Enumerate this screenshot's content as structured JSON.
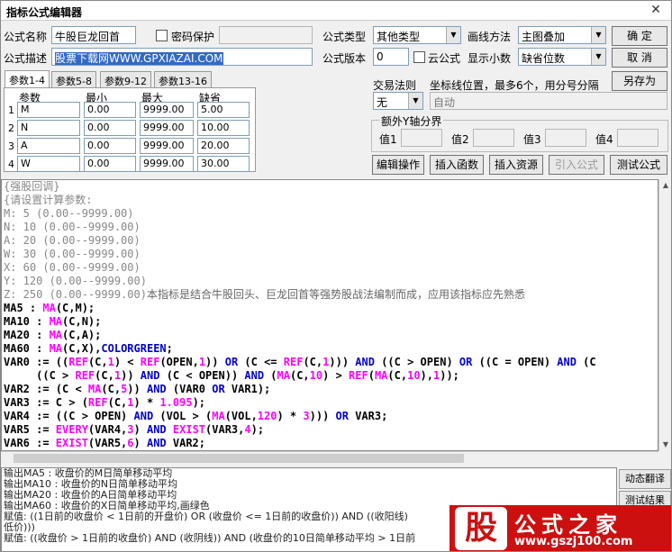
{
  "window": {
    "title": "指标公式编辑器",
    "close": "✕"
  },
  "form": {
    "name_label": "公式名称",
    "name_value": "牛股巨龙回首",
    "password_label": "密码保护",
    "desc_label": "公式描述",
    "desc_value": "股票下载网WWW.GPXIAZAI.COM",
    "type_label": "公式类型",
    "type_value": "其他类型",
    "draw_label": "画线方法",
    "draw_value": "主图叠加",
    "version_label": "公式版本",
    "version_value": "0",
    "cloud_label": "云公式",
    "decimal_label": "显示小数",
    "decimal_value": "缺省位数",
    "trade_label": "交易法则",
    "trade_value": "无",
    "axis_label": "坐标线位置，最多6个，用分号分隔",
    "axis_value": "自动",
    "yaxis_group": "额外Y轴分界",
    "yaxis_labels": [
      "值1",
      "值2",
      "值3",
      "值4"
    ]
  },
  "buttons": {
    "ok": "确  定",
    "cancel": "取  消",
    "saveas": "另存为",
    "edit_op": "编辑操作",
    "insert_fn": "插入函数",
    "insert_res": "插入资源",
    "import": "引入公式",
    "test": "测试公式"
  },
  "tabs": [
    "参数1-4",
    "参数5-8",
    "参数9-12",
    "参数13-16"
  ],
  "param_table": {
    "headers": [
      "参数",
      "最小",
      "最大",
      "缺省"
    ],
    "rows": [
      {
        "idx": "1",
        "name": "M",
        "min": "0.00",
        "max": "9999.00",
        "def": "5.00"
      },
      {
        "idx": "2",
        "name": "N",
        "min": "0.00",
        "max": "9999.00",
        "def": "10.00"
      },
      {
        "idx": "3",
        "name": "A",
        "min": "0.00",
        "max": "9999.00",
        "def": "20.00"
      },
      {
        "idx": "4",
        "name": "W",
        "min": "0.00",
        "max": "9999.00",
        "def": "30.00"
      }
    ]
  },
  "code_lines": [
    [
      {
        "c": "gray",
        "t": "{强股回调}"
      }
    ],
    [
      {
        "c": "gray",
        "t": "{请设置计算参数:"
      }
    ],
    [
      {
        "c": "gray",
        "t": "M: 5 (0.00--9999.00)"
      }
    ],
    [
      {
        "c": "gray",
        "t": "N: 10 (0.00--9999.00)"
      }
    ],
    [
      {
        "c": "gray",
        "t": "A: 20 (0.00--9999.00)"
      }
    ],
    [
      {
        "c": "gray",
        "t": "W: 30 (0.00--9999.00)"
      }
    ],
    [
      {
        "c": "gray",
        "t": "X: 60 (0.00--9999.00)"
      }
    ],
    [
      {
        "c": "gray",
        "t": "Y: 120 (0.00--9999.00)"
      }
    ],
    [
      {
        "c": "gray",
        "t": "Z: 250 (0.00--9999.00)"
      },
      {
        "c": "com",
        "t": "本指标是结合牛股回头、巨龙回首等强势股战法编制而成，应用该指标应先熟悉"
      }
    ],
    [
      {
        "c": "kw",
        "t": "MA5 : "
      },
      {
        "c": "fn",
        "t": "MA"
      },
      {
        "c": "kw",
        "t": "(C,M);"
      }
    ],
    [
      {
        "c": "kw",
        "t": "MA10 : "
      },
      {
        "c": "fn",
        "t": "MA"
      },
      {
        "c": "kw",
        "t": "(C,N);"
      }
    ],
    [
      {
        "c": "kw",
        "t": "MA20 : "
      },
      {
        "c": "fn",
        "t": "MA"
      },
      {
        "c": "kw",
        "t": "(C,A);"
      }
    ],
    [
      {
        "c": "kw",
        "t": "MA60 : "
      },
      {
        "c": "fn",
        "t": "MA"
      },
      {
        "c": "kw",
        "t": "(C,X),"
      },
      {
        "c": "op",
        "t": "COLORGREEN"
      },
      {
        "c": "kw",
        "t": ";"
      }
    ],
    [
      {
        "c": "kw",
        "t": "VAR0 := (("
      },
      {
        "c": "fn",
        "t": "REF"
      },
      {
        "c": "kw",
        "t": "(C,"
      },
      {
        "c": "num",
        "t": "1"
      },
      {
        "c": "kw",
        "t": ") < "
      },
      {
        "c": "fn",
        "t": "REF"
      },
      {
        "c": "kw",
        "t": "(OPEN,"
      },
      {
        "c": "num",
        "t": "1"
      },
      {
        "c": "kw",
        "t": ")) "
      },
      {
        "c": "op",
        "t": "OR"
      },
      {
        "c": "kw",
        "t": " (C <= "
      },
      {
        "c": "fn",
        "t": "REF"
      },
      {
        "c": "kw",
        "t": "(C,"
      },
      {
        "c": "num",
        "t": "1"
      },
      {
        "c": "kw",
        "t": "))) "
      },
      {
        "c": "op",
        "t": "AND"
      },
      {
        "c": "kw",
        "t": " ((C > OPEN) "
      },
      {
        "c": "op",
        "t": "OR"
      },
      {
        "c": "kw",
        "t": " ((C = OPEN) "
      },
      {
        "c": "op",
        "t": "AND"
      },
      {
        "c": "kw",
        "t": " (C"
      }
    ],
    [
      {
        "c": "kw",
        "t": "     ((C > "
      },
      {
        "c": "fn",
        "t": "REF"
      },
      {
        "c": "kw",
        "t": "(C,"
      },
      {
        "c": "num",
        "t": "1"
      },
      {
        "c": "kw",
        "t": ")) "
      },
      {
        "c": "op",
        "t": "AND"
      },
      {
        "c": "kw",
        "t": " (C < OPEN)) "
      },
      {
        "c": "op",
        "t": "AND"
      },
      {
        "c": "kw",
        "t": " ("
      },
      {
        "c": "fn",
        "t": "MA"
      },
      {
        "c": "kw",
        "t": "(C,"
      },
      {
        "c": "num",
        "t": "10"
      },
      {
        "c": "kw",
        "t": ") > "
      },
      {
        "c": "fn",
        "t": "REF"
      },
      {
        "c": "kw",
        "t": "("
      },
      {
        "c": "fn",
        "t": "MA"
      },
      {
        "c": "kw",
        "t": "(C,"
      },
      {
        "c": "num",
        "t": "10"
      },
      {
        "c": "kw",
        "t": "),"
      },
      {
        "c": "num",
        "t": "1"
      },
      {
        "c": "kw",
        "t": "));"
      }
    ],
    [
      {
        "c": "kw",
        "t": "VAR2 := (C < "
      },
      {
        "c": "fn",
        "t": "MA"
      },
      {
        "c": "kw",
        "t": "(C,"
      },
      {
        "c": "num",
        "t": "5"
      },
      {
        "c": "kw",
        "t": ")) "
      },
      {
        "c": "op",
        "t": "AND"
      },
      {
        "c": "kw",
        "t": " (VAR0 "
      },
      {
        "c": "op",
        "t": "OR"
      },
      {
        "c": "kw",
        "t": " VAR1);"
      }
    ],
    [
      {
        "c": "kw",
        "t": "VAR3 := C > ("
      },
      {
        "c": "fn",
        "t": "REF"
      },
      {
        "c": "kw",
        "t": "(C,"
      },
      {
        "c": "num",
        "t": "1"
      },
      {
        "c": "kw",
        "t": ") * "
      },
      {
        "c": "num",
        "t": "1.095"
      },
      {
        "c": "kw",
        "t": ");"
      }
    ],
    [
      {
        "c": "kw",
        "t": "VAR4 := ((C > OPEN) "
      },
      {
        "c": "op",
        "t": "AND"
      },
      {
        "c": "kw",
        "t": " (VOL > ("
      },
      {
        "c": "fn",
        "t": "MA"
      },
      {
        "c": "kw",
        "t": "(VOL,"
      },
      {
        "c": "num",
        "t": "120"
      },
      {
        "c": "kw",
        "t": ") * "
      },
      {
        "c": "num",
        "t": "3"
      },
      {
        "c": "kw",
        "t": "))) "
      },
      {
        "c": "op",
        "t": "OR"
      },
      {
        "c": "kw",
        "t": " VAR3;"
      }
    ],
    [
      {
        "c": "kw",
        "t": "VAR5 := "
      },
      {
        "c": "fn",
        "t": "EVERY"
      },
      {
        "c": "kw",
        "t": "(VAR4,"
      },
      {
        "c": "num",
        "t": "3"
      },
      {
        "c": "kw",
        "t": ") "
      },
      {
        "c": "op",
        "t": "AND"
      },
      {
        "c": "kw",
        "t": " "
      },
      {
        "c": "fn",
        "t": "EXIST"
      },
      {
        "c": "kw",
        "t": "(VAR3,"
      },
      {
        "c": "num",
        "t": "4"
      },
      {
        "c": "kw",
        "t": ");"
      }
    ],
    [
      {
        "c": "kw",
        "t": "VAR6 := "
      },
      {
        "c": "fn",
        "t": "EXIST"
      },
      {
        "c": "kw",
        "t": "(VAR5,"
      },
      {
        "c": "num",
        "t": "6"
      },
      {
        "c": "kw",
        "t": ") "
      },
      {
        "c": "op",
        "t": "AND"
      },
      {
        "c": "kw",
        "t": " VAR2;"
      }
    ]
  ],
  "desc_lines": [
    "输出MA5 : 收盘价的M日简单移动平均",
    "输出MA10 : 收盘价的N日简单移动平均",
    "输出MA20 : 收盘价的A日简单移动平均",
    "输出MA60 : 收盘价的X日简单移动平均,画绿色",
    "赋值: ((1日前的收盘价 < 1日前的开盘价) OR (收盘价 <= 1日前的收盘价)) AND ((收阳线)",
    "低价)))",
    "赋值: ((收盘价 > 1日前的收盘价) AND (收阴线)) AND (收盘价的10日简单移动平均 > 1日前"
  ],
  "side_buttons": [
    "动态翻译",
    "测试结果"
  ],
  "watermark": {
    "logo": "股",
    "title": "公式之家",
    "url": "www.gszj100.com"
  }
}
